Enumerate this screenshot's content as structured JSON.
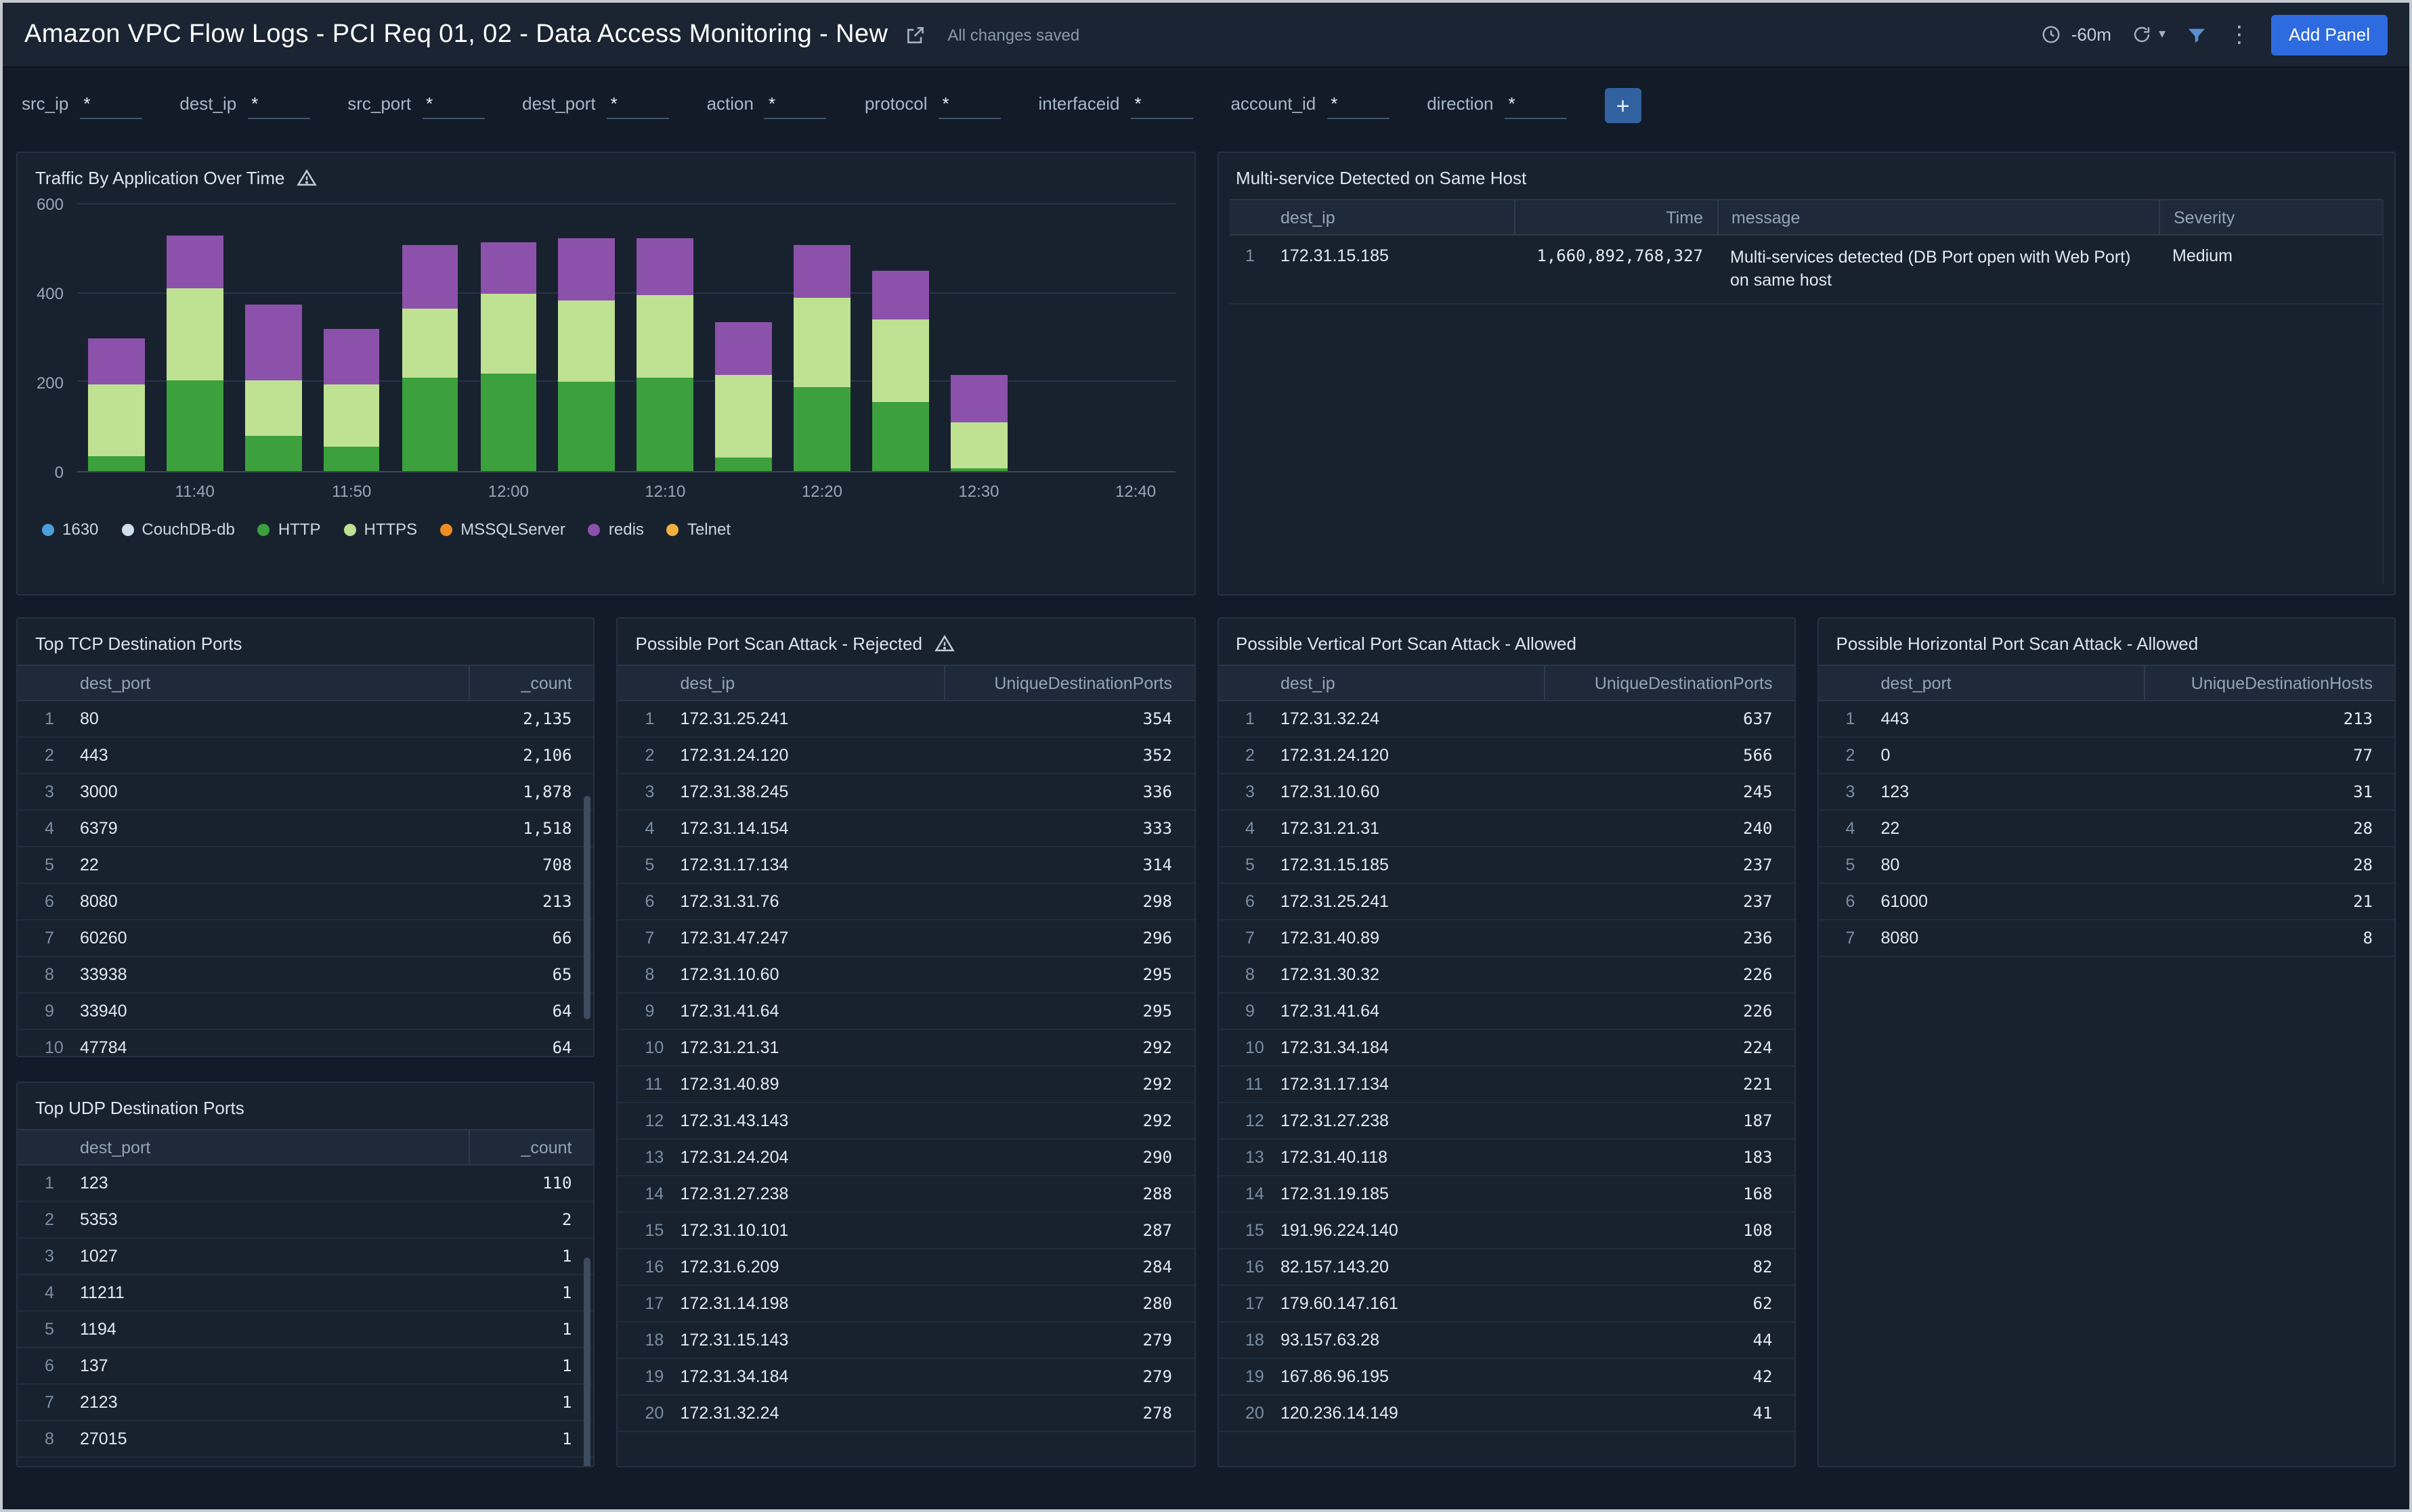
{
  "header": {
    "title": "Amazon VPC Flow Logs - PCI Req 01, 02 - Data Access Monitoring - New",
    "saved_status": "All changes saved",
    "time_range": "-60m",
    "add_panel_label": "Add Panel"
  },
  "icons": {
    "kebab": "⋮",
    "chevron": "▾"
  },
  "filters": {
    "add_button": "+",
    "items": [
      {
        "label": "src_ip",
        "value": "*"
      },
      {
        "label": "dest_ip",
        "value": "*"
      },
      {
        "label": "src_port",
        "value": "*"
      },
      {
        "label": "dest_port",
        "value": "*"
      },
      {
        "label": "action",
        "value": "*"
      },
      {
        "label": "protocol",
        "value": "*"
      },
      {
        "label": "interfaceid",
        "value": "*"
      },
      {
        "label": "account_id",
        "value": "*"
      },
      {
        "label": "direction",
        "value": "*"
      }
    ]
  },
  "panels": {
    "traffic": {
      "title": "Traffic By Application Over Time",
      "chart_data": {
        "type": "bar",
        "stacked": true,
        "title": "Traffic By Application Over Time",
        "x": [
          "11:35",
          "11:40",
          "11:45",
          "11:50",
          "11:55",
          "12:00",
          "12:05",
          "12:10",
          "12:15",
          "12:20",
          "12:25",
          "12:30"
        ],
        "slot_labels": [
          "",
          "11:40",
          "",
          "11:50",
          "",
          "12:00",
          "",
          "12:10",
          "",
          "12:20",
          "",
          "12:30",
          "",
          "12:40"
        ],
        "ylim": [
          0,
          600
        ],
        "yticks": [
          0,
          200,
          400,
          600
        ],
        "grid": true,
        "legend_position": "bottom",
        "series": [
          {
            "name": "1630",
            "color": "#4d9fdb",
            "values": [
              0,
              0,
              0,
              0,
              0,
              0,
              0,
              0,
              0,
              0,
              0,
              0
            ]
          },
          {
            "name": "CouchDB-db",
            "color": "#cfdeec",
            "values": [
              0,
              0,
              0,
              0,
              0,
              0,
              0,
              0,
              0,
              0,
              0,
              0
            ]
          },
          {
            "name": "HTTP",
            "color": "#3ca03c",
            "values": [
              35,
              205,
              80,
              55,
              210,
              220,
              200,
              210,
              30,
              190,
              155,
              5
            ]
          },
          {
            "name": "HTTPS",
            "color": "#bfe292",
            "values": [
              160,
              205,
              125,
              140,
              155,
              180,
              185,
              185,
              185,
              200,
              185,
              105
            ]
          },
          {
            "name": "MSSQLServer",
            "color": "#ef8d1f",
            "values": [
              0,
              0,
              0,
              0,
              0,
              0,
              0,
              0,
              0,
              0,
              0,
              0
            ]
          },
          {
            "name": "redis",
            "color": "#8c51ab",
            "values": [
              105,
              120,
              170,
              125,
              145,
              115,
              140,
              130,
              120,
              120,
              110,
              105
            ]
          },
          {
            "name": "Telnet",
            "color": "#efb13e",
            "values": [
              0,
              0,
              0,
              0,
              0,
              0,
              0,
              0,
              0,
              0,
              0,
              0
            ]
          }
        ]
      }
    },
    "multiservice": {
      "title": "Multi-service Detected on Same Host",
      "columns": [
        "dest_ip",
        "Time",
        "message",
        "Severity"
      ],
      "rows": [
        [
          "172.31.15.185",
          "1,660,892,768,327",
          "Multi-services detected (DB Port open with Web Port) on same host",
          "Medium"
        ]
      ]
    },
    "top_tcp": {
      "title": "Top TCP Destination Ports",
      "columns": [
        "dest_port",
        "_count"
      ],
      "rows": [
        [
          "80",
          "2,135"
        ],
        [
          "443",
          "2,106"
        ],
        [
          "3000",
          "1,878"
        ],
        [
          "6379",
          "1,518"
        ],
        [
          "22",
          "708"
        ],
        [
          "8080",
          "213"
        ],
        [
          "60260",
          "66"
        ],
        [
          "33938",
          "65"
        ],
        [
          "33940",
          "64"
        ],
        [
          "47784",
          "64"
        ]
      ]
    },
    "top_udp": {
      "title": "Top UDP Destination Ports",
      "columns": [
        "dest_port",
        "_count"
      ],
      "rows": [
        [
          "123",
          "110"
        ],
        [
          "5353",
          "2"
        ],
        [
          "1027",
          "1"
        ],
        [
          "11211",
          "1"
        ],
        [
          "1194",
          "1"
        ],
        [
          "137",
          "1"
        ],
        [
          "2123",
          "1"
        ],
        [
          "27015",
          "1"
        ]
      ]
    },
    "scan_rejected": {
      "title": "Possible Port Scan Attack - Rejected",
      "columns": [
        "dest_ip",
        "UniqueDestinationPorts"
      ],
      "rows": [
        [
          "172.31.25.241",
          "354"
        ],
        [
          "172.31.24.120",
          "352"
        ],
        [
          "172.31.38.245",
          "336"
        ],
        [
          "172.31.14.154",
          "333"
        ],
        [
          "172.31.17.134",
          "314"
        ],
        [
          "172.31.31.76",
          "298"
        ],
        [
          "172.31.47.247",
          "296"
        ],
        [
          "172.31.10.60",
          "295"
        ],
        [
          "172.31.41.64",
          "295"
        ],
        [
          "172.31.21.31",
          "292"
        ],
        [
          "172.31.40.89",
          "292"
        ],
        [
          "172.31.43.143",
          "292"
        ],
        [
          "172.31.24.204",
          "290"
        ],
        [
          "172.31.27.238",
          "288"
        ],
        [
          "172.31.10.101",
          "287"
        ],
        [
          "172.31.6.209",
          "284"
        ],
        [
          "172.31.14.198",
          "280"
        ],
        [
          "172.31.15.143",
          "279"
        ],
        [
          "172.31.34.184",
          "279"
        ],
        [
          "172.31.32.24",
          "278"
        ]
      ]
    },
    "scan_vertical": {
      "title": "Possible Vertical Port Scan Attack - Allowed",
      "columns": [
        "dest_ip",
        "UniqueDestinationPorts"
      ],
      "rows": [
        [
          "172.31.32.24",
          "637"
        ],
        [
          "172.31.24.120",
          "566"
        ],
        [
          "172.31.10.60",
          "245"
        ],
        [
          "172.31.21.31",
          "240"
        ],
        [
          "172.31.15.185",
          "237"
        ],
        [
          "172.31.25.241",
          "237"
        ],
        [
          "172.31.40.89",
          "236"
        ],
        [
          "172.31.30.32",
          "226"
        ],
        [
          "172.31.41.64",
          "226"
        ],
        [
          "172.31.34.184",
          "224"
        ],
        [
          "172.31.17.134",
          "221"
        ],
        [
          "172.31.27.238",
          "187"
        ],
        [
          "172.31.40.118",
          "183"
        ],
        [
          "172.31.19.185",
          "168"
        ],
        [
          "191.96.224.140",
          "108"
        ],
        [
          "82.157.143.20",
          "82"
        ],
        [
          "179.60.147.161",
          "62"
        ],
        [
          "93.157.63.28",
          "44"
        ],
        [
          "167.86.96.195",
          "42"
        ],
        [
          "120.236.14.149",
          "41"
        ]
      ]
    },
    "scan_horizontal": {
      "title": "Possible Horizontal Port Scan Attack - Allowed",
      "columns": [
        "dest_port",
        "UniqueDestinationHosts"
      ],
      "rows": [
        [
          "443",
          "213"
        ],
        [
          "0",
          "77"
        ],
        [
          "123",
          "31"
        ],
        [
          "22",
          "28"
        ],
        [
          "80",
          "28"
        ],
        [
          "61000",
          "21"
        ],
        [
          "8080",
          "8"
        ]
      ]
    }
  }
}
